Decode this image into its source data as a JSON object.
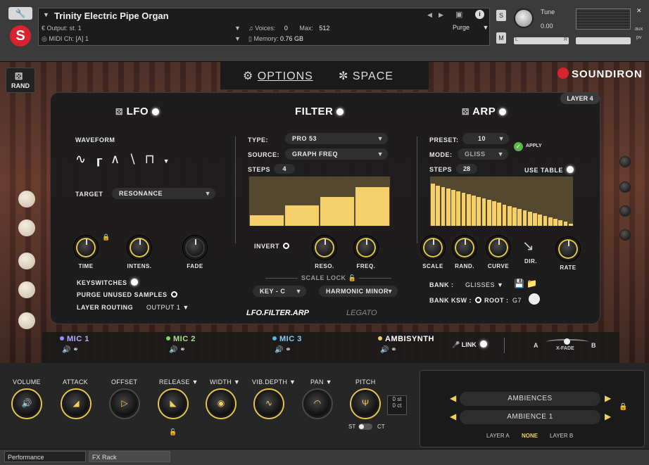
{
  "header": {
    "instrument_name": "Trinity Electric Pipe Organ",
    "output_label": "Output:",
    "output_value": "st. 1",
    "midi_label": "MIDI Ch:",
    "midi_value": "[A] 1",
    "voices_label": "Voices:",
    "voices_value": "0",
    "max_label": "Max:",
    "max_value": "512",
    "memory_label": "Memory:",
    "memory_value": "0.76 GB",
    "purge_label": "Purge",
    "solo_label": "S",
    "mute_label": "M",
    "tune_label": "Tune",
    "tune_value": "0.00",
    "aux_label": "aux",
    "pv_label": "pv",
    "pan_left": "L",
    "pan_right": "R"
  },
  "nav": {
    "rand_label": "RAND",
    "tabs": [
      {
        "label": "OPTIONS"
      },
      {
        "label": "SPACE"
      }
    ],
    "brand": "SOUNDIRON"
  },
  "panel": {
    "layer_badge": "LAYER 4",
    "lfo": {
      "title": "LFO",
      "waveform_label": "WAVEFORM",
      "target_label": "TARGET",
      "target_value": "RESONANCE",
      "knobs": [
        {
          "label": "TIME"
        },
        {
          "label": "INTENS."
        },
        {
          "label": "FADE"
        }
      ],
      "keyswitches_label": "KEYSWITCHES",
      "purge_unused_label": "PURGE UNUSED SAMPLES",
      "layer_routing_label": "LAYER ROUTING",
      "layer_routing_value": "OUTPUT 1"
    },
    "filter": {
      "title": "FILTER",
      "type_label": "TYPE:",
      "type_value": "PRO 53",
      "source_label": "SOURCE:",
      "source_value": "GRAPH FREQ",
      "steps_label": "STEPS",
      "steps_value": "4",
      "step_values": [
        0.21,
        0.42,
        0.58,
        0.79
      ],
      "invert_label": "INVERT",
      "knobs": [
        {
          "label": "RESO."
        },
        {
          "label": "FREQ."
        }
      ],
      "scale_lock_label": "SCALE LOCK",
      "key_value": "KEY - C",
      "scale_value": "HARMONIC MINOR",
      "routing_label": "LFO.FILTER.ARP",
      "legato_label": "LEGATO"
    },
    "arp": {
      "title": "ARP",
      "preset_label": "PRESET:",
      "preset_value": "10",
      "apply_label": "APPLY",
      "mode_label": "MODE:",
      "mode_value": "GLISS",
      "steps_label": "STEPS",
      "steps_value": "28",
      "use_table_label": "USE TABLE",
      "knobs": [
        {
          "label": "SCALE"
        },
        {
          "label": "RAND."
        },
        {
          "label": "CURVE"
        },
        {
          "label": "DIR."
        },
        {
          "label": "RATE"
        }
      ],
      "bank_label": "BANK :",
      "bank_value": "GLISSES",
      "bank_ksw_label": "BANK KSW :",
      "root_label": "ROOT :",
      "root_value": "G7"
    }
  },
  "mics": [
    {
      "label": "MIC 1",
      "color": "#9a8cff"
    },
    {
      "label": "MIC 2",
      "color": "#7fd65a"
    },
    {
      "label": "MIC 3",
      "color": "#5ab4e6"
    },
    {
      "label": "AMBISYNTH",
      "color": "#f2cf5a"
    }
  ],
  "mic_link_label": "LINK",
  "xfade": {
    "a": "A",
    "label": "X-FADE",
    "b": "B"
  },
  "bottom": {
    "knobs": [
      {
        "label": "VOLUME"
      },
      {
        "label": "ATTACK"
      },
      {
        "label": "OFFSET"
      },
      {
        "label": "RELEASE"
      },
      {
        "label": "WIDTH"
      },
      {
        "label": "VIB.DEPTH"
      },
      {
        "label": "PAN"
      },
      {
        "label": "PITCH"
      }
    ],
    "pitch_st": "0 st",
    "pitch_ct": "0 ct",
    "st_label": "ST",
    "ct_label": "CT",
    "ambiences_label": "AMBIENCES",
    "ambience_value": "AMBIENCE 1",
    "layer_a": "LAYER A",
    "layer_none": "NONE",
    "layer_b": "LAYER B"
  },
  "footer": {
    "tabs": [
      {
        "label": "Performance"
      },
      {
        "label": "FX Rack"
      }
    ]
  },
  "colors": {
    "accent": "#f2cf5a",
    "brand_red": "#d9232e"
  }
}
